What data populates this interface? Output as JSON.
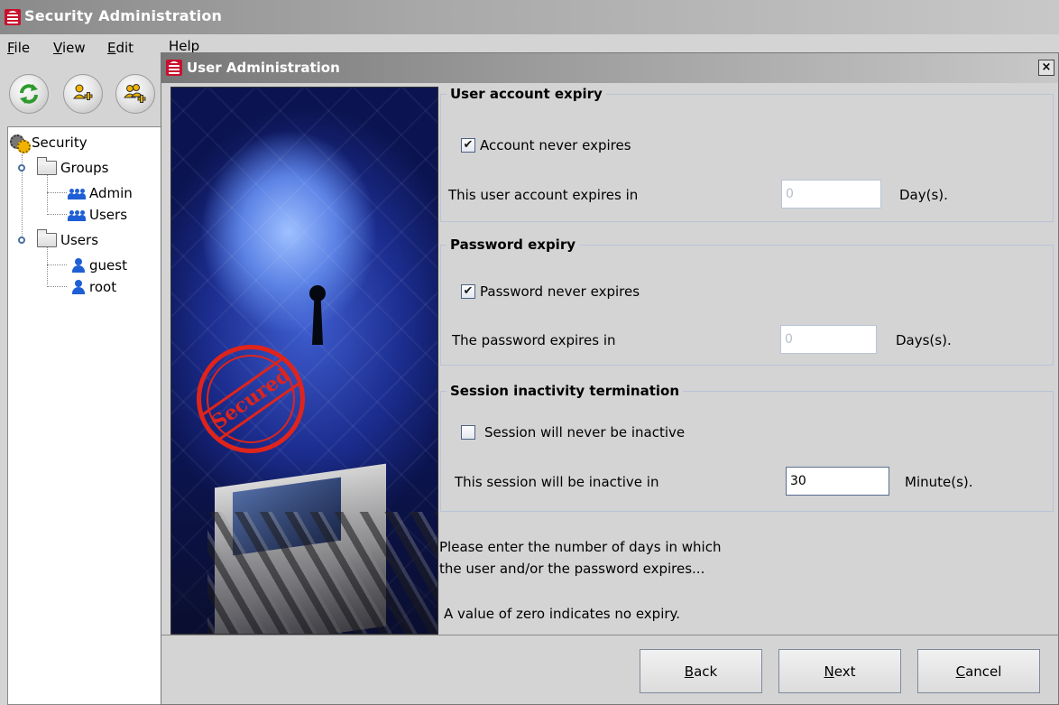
{
  "main_window": {
    "title": "Security Administration",
    "menu": [
      {
        "mnemonic": "F",
        "rest": "ile"
      },
      {
        "mnemonic": "V",
        "rest": "iew"
      },
      {
        "mnemonic": "E",
        "rest": "dit"
      },
      {
        "mnemonic": "",
        "rest": "Help"
      }
    ],
    "toolbar": [
      {
        "icon": "refresh-icon"
      },
      {
        "icon": "add-user-icon"
      },
      {
        "icon": "add-group-icon"
      }
    ],
    "tree": {
      "root": "Security",
      "groups_label": "Groups",
      "groups": [
        "Admin",
        "Users"
      ],
      "users_label": "Users",
      "users": [
        "guest",
        "root"
      ]
    }
  },
  "dialog": {
    "title": "User Administration",
    "close_glyph": "×",
    "banner_stamp": "Secured",
    "account_expiry": {
      "title": "User account expiry",
      "never_label": "Account never expires",
      "never_checked": "✔",
      "expires_label": "This user account expires in",
      "value": "0",
      "unit": "Day(s)."
    },
    "password_expiry": {
      "title": "Password expiry",
      "never_label": "Password never expires",
      "never_checked": "✔",
      "expires_label": "The password expires in",
      "value": "0",
      "unit": "Days(s)."
    },
    "session": {
      "title": "Session inactivity termination",
      "never_label": "Session will never be inactive",
      "never_checked": "",
      "expires_label": "This session will be inactive in",
      "value": "30",
      "unit": "Minute(s)."
    },
    "help": {
      "line1": "Please enter the number of days in which",
      "line2": "the user and/or the password expires...",
      "line3": "A value of zero indicates no expiry."
    },
    "buttons": {
      "back": {
        "mnemonic": "B",
        "rest": "ack"
      },
      "next": {
        "mnemonic": "N",
        "rest": "ext"
      },
      "cancel": {
        "mnemonic": "C",
        "rest": "ancel"
      }
    }
  }
}
